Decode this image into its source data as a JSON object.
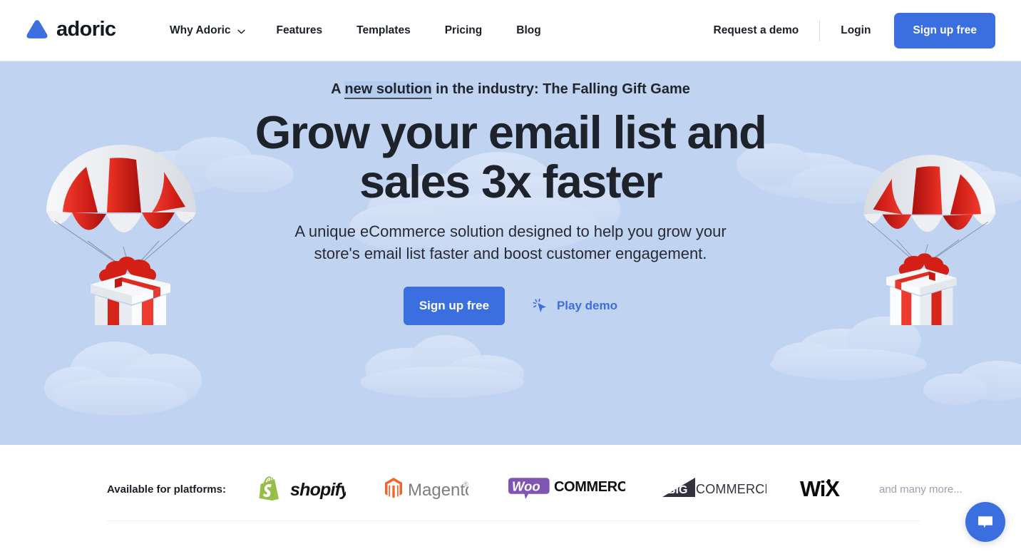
{
  "header": {
    "logo": {
      "text": "adoric",
      "icon": "triangle-logo-icon",
      "color": "#3b6fe0"
    },
    "nav": [
      {
        "label": "Why Adoric",
        "has_dropdown": true,
        "icon": "chevron-down-icon"
      },
      {
        "label": "Features",
        "has_dropdown": false
      },
      {
        "label": "Templates",
        "has_dropdown": false
      },
      {
        "label": "Pricing",
        "has_dropdown": false
      },
      {
        "label": "Blog",
        "has_dropdown": false
      }
    ],
    "request_demo": "Request a demo",
    "login": "Login",
    "signup": "Sign up free"
  },
  "hero": {
    "eyebrow_before": "A ",
    "eyebrow_highlight": "new solution",
    "eyebrow_after": " in the industry: The Falling Gift Game",
    "heading_line1": "Grow your email list and",
    "heading_line2": "sales 3x faster",
    "subheading_line1": "A unique eCommerce solution designed to help you grow your",
    "subheading_line2": "store's email list faster and boost customer engagement.",
    "primary_cta": "Sign up free",
    "secondary_cta": "Play demo",
    "secondary_cta_icon": "cursor-click-icon",
    "background_color": "#c0d3f0",
    "cloud_color": "#cfdef5",
    "accent_color": "#3b6fe0",
    "illustration_left": "parachute-gift-illustration",
    "illustration_right": "parachute-gift-illustration"
  },
  "platforms": {
    "label": "Available for platforms:",
    "logos": [
      {
        "name": "shopify-logo",
        "text": "shopify",
        "color": "#95bf47"
      },
      {
        "name": "magento-logo",
        "text": "Magento",
        "color": "#ee672f"
      },
      {
        "name": "woocommerce-logo",
        "text_a": "Woo",
        "text_b": "COMMERCE",
        "color": "#7f54b3"
      },
      {
        "name": "bigcommerce-logo",
        "text_a": "BIG",
        "text_b": "COMMERCE",
        "color": "#34313f"
      },
      {
        "name": "wix-logo",
        "text": "WiX",
        "color": "#000000"
      }
    ],
    "more_text": "and many more..."
  },
  "chat": {
    "name": "chat-widget-button",
    "icon": "speech-bubble-icon",
    "color": "#3b6fe0"
  }
}
